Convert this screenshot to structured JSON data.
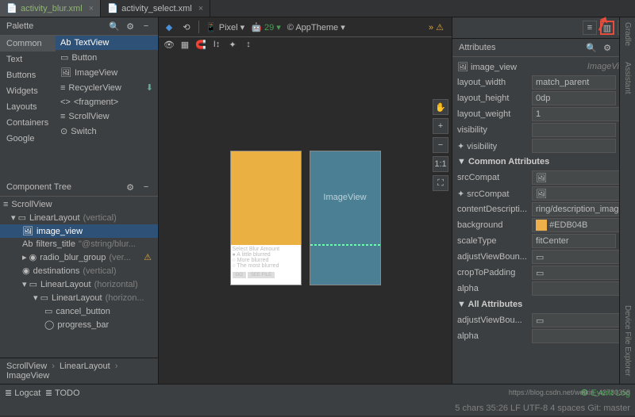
{
  "tabs": {
    "t0": "activity_blur.xml",
    "t1": "activity_select.xml"
  },
  "palette": {
    "title": "Palette",
    "cats": [
      "Common",
      "Text",
      "Buttons",
      "Widgets",
      "Layouts",
      "Containers",
      "Google"
    ],
    "items": [
      "TextView",
      "Button",
      "ImageView",
      "RecyclerView",
      "<fragment>",
      "ScrollView",
      "Switch"
    ]
  },
  "tree": {
    "title": "Component Tree",
    "rows": [
      {
        "t": "ScrollView",
        "lvl": 0
      },
      {
        "t": "LinearLayout",
        "hint": "(vertical)",
        "lvl": 1
      },
      {
        "t": "image_view",
        "lvl": 2,
        "sel": true
      },
      {
        "t": "filters_title",
        "hint": "\"@string/blur...",
        "lvl": 2,
        "ab": true
      },
      {
        "t": "radio_blur_group",
        "hint": "(ver...",
        "lvl": 2,
        "dot": true,
        "warn": true
      },
      {
        "t": "destinations",
        "hint": "(vertical)",
        "lvl": 2,
        "dot": true
      },
      {
        "t": "LinearLayout",
        "hint": "(horizontal)",
        "lvl": 2
      },
      {
        "t": "LinearLayout",
        "hint": "(horizon...",
        "lvl": 3
      },
      {
        "t": "cancel_button",
        "lvl": 4
      },
      {
        "t": "progress_bar",
        "lvl": 4
      }
    ]
  },
  "breadcrumb": {
    "a": "ScrollView",
    "b": "LinearLayout",
    "c": "ImageView"
  },
  "toolbar": {
    "device": "Pixel",
    "api": "29",
    "theme": "AppTheme"
  },
  "attributes": {
    "title": "Attributes",
    "id": "image_view",
    "type": "ImageView",
    "layout_width": "match_parent",
    "layout_height": "0dp",
    "layout_weight": "1",
    "visibility": "",
    "fvisibility": "",
    "sec_common": "Common Attributes",
    "srcCompat": "",
    "fsrcCompat": "",
    "contentDescription": "ring/description_image",
    "background": "#EDB04B",
    "scaleType": "fitCenter",
    "adjustViewBounds": "",
    "cropToPadding": "",
    "alpha": "",
    "sec_all": "All Attributes",
    "adjustViewBou": "",
    "alpha2": ""
  },
  "blueprint": {
    "label": "ImageView"
  },
  "modes": {
    "code": "≡",
    "split": "▥",
    "design": "▧"
  },
  "sideTools": {
    "pan": "✋",
    "zoomIn": "+",
    "zoomOut": "−",
    "fit": "1:1",
    "full": "⛶"
  },
  "status": {
    "logcat": "Logcat",
    "todo": "TODO",
    "eventlog": "Event Log",
    "info": "5 chars   35:26    LF   UTF-8   4 spaces   Git: master"
  },
  "vtabs": {
    "gradle": "Gradle",
    "assistant": "Assistant",
    "device": "Device File Explorer"
  },
  "watermark": "https://blog.csdn.net/weixin_42730358"
}
